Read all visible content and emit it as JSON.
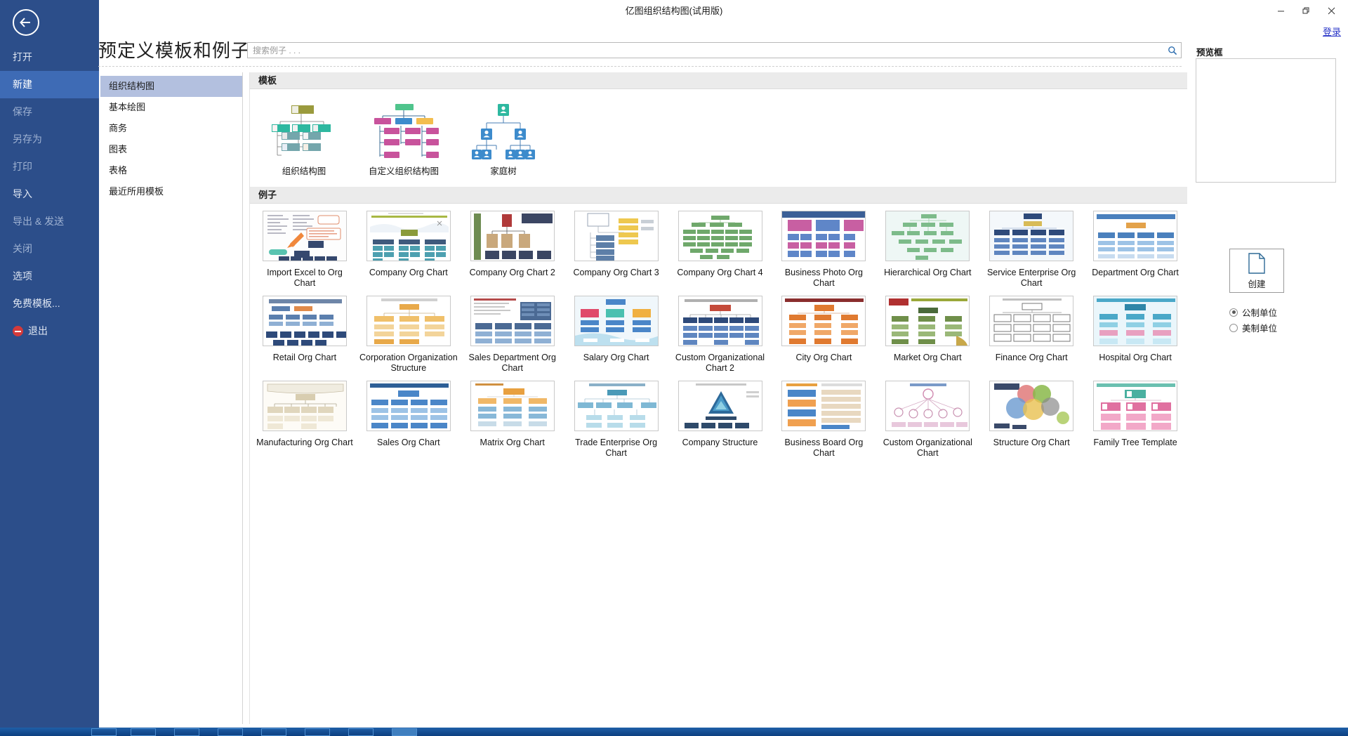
{
  "window": {
    "title": "亿图组织结构图(试用版)",
    "minimize": "−",
    "restore": "❐",
    "close": "✕",
    "login_link": "登录"
  },
  "left_nav": {
    "back_icon": "back-arrow-icon",
    "items": [
      {
        "label": "打开",
        "state": "normal"
      },
      {
        "label": "新建",
        "state": "active"
      },
      {
        "label": "保存",
        "state": "dim"
      },
      {
        "label": "另存为",
        "state": "dim"
      },
      {
        "label": "打印",
        "state": "dim"
      },
      {
        "label": "导入",
        "state": "normal"
      },
      {
        "label": "导出 & 发送",
        "state": "dim"
      },
      {
        "label": "关闭",
        "state": "dim"
      },
      {
        "label": "选项",
        "state": "normal"
      },
      {
        "label": "免费模板...",
        "state": "normal"
      },
      {
        "label": "退出",
        "state": "exit"
      }
    ]
  },
  "header": {
    "page_title": "预定义模板和例子",
    "search_placeholder": "搜索例子 . . ."
  },
  "categories": [
    {
      "label": "组织结构图",
      "selected": true
    },
    {
      "label": "基本绘图",
      "selected": false
    },
    {
      "label": "商务",
      "selected": false
    },
    {
      "label": "图表",
      "selected": false
    },
    {
      "label": "表格",
      "selected": false
    },
    {
      "label": "最近所用模板",
      "selected": false
    }
  ],
  "sections": {
    "templates_heading": "模板",
    "examples_heading": "例子"
  },
  "templates": [
    {
      "label": "组织结构图",
      "style": "olive-teal"
    },
    {
      "label": "自定义组织结构图",
      "style": "green-magenta"
    },
    {
      "label": "家庭树",
      "style": "blue-people"
    }
  ],
  "examples": [
    {
      "label": "Import Excel to Org Chart",
      "style": "sketch"
    },
    {
      "label": "Company Org Chart",
      "style": "olive-teal-wide"
    },
    {
      "label": "Company Org Chart 2",
      "style": "portrait-brown"
    },
    {
      "label": "Company Org Chart 3",
      "style": "yellow-tree"
    },
    {
      "label": "Company Org Chart 4",
      "style": "green-dense"
    },
    {
      "label": "Business Photo Org Chart",
      "style": "photo-grid"
    },
    {
      "label": "Hierarchical Org Chart",
      "style": "mint-radial"
    },
    {
      "label": "Service Enterprise Org Chart",
      "style": "navy-grid"
    },
    {
      "label": "Department Org Chart",
      "style": "blue-band"
    },
    {
      "label": "Retail Org Chart",
      "style": "retail-blue"
    },
    {
      "label": "Corporation Organization Structure",
      "style": "orange-chart"
    },
    {
      "label": "Sales Department Org Chart",
      "style": "sales-doc"
    },
    {
      "label": "Salary Org Chart",
      "style": "salary-color"
    },
    {
      "label": "Custom Organizational Chart 2",
      "style": "red-navy"
    },
    {
      "label": "City Org Chart",
      "style": "city-orange"
    },
    {
      "label": "Market Org Chart",
      "style": "market-green"
    },
    {
      "label": "Finance Org Chart",
      "style": "finance-mono"
    },
    {
      "label": "Hospital Org Chart",
      "style": "hospital-teal"
    },
    {
      "label": "Manufacturing Org Chart",
      "style": "manuf-tan"
    },
    {
      "label": "Sales Org Chart",
      "style": "sales-blue"
    },
    {
      "label": "Matrix Org Chart",
      "style": "matrix-orange"
    },
    {
      "label": "Trade Enterprise Org Chart",
      "style": "trade-cyan"
    },
    {
      "label": "Company Structure",
      "style": "pyramid"
    },
    {
      "label": "Business Board Org Chart",
      "style": "board-orange"
    },
    {
      "label": "Custom Organizational Chart",
      "style": "custom-radial"
    },
    {
      "label": "Structure Org Chart",
      "style": "venn"
    },
    {
      "label": "Family Tree Template",
      "style": "family-pink"
    }
  ],
  "preview": {
    "title": "预览框",
    "create_button": "创建",
    "create_icon": "document-icon",
    "units": [
      {
        "label": "公制单位",
        "checked": true
      },
      {
        "label": "美制单位",
        "checked": false
      }
    ]
  },
  "colors": {
    "nav_blue": "#2c4e8a",
    "nav_active": "#3e6bb5",
    "category_selected": "#b3c0df",
    "section_header": "#ebebeb",
    "link_blue": "#2a36c8",
    "taskbar": "#1f5fa8"
  }
}
